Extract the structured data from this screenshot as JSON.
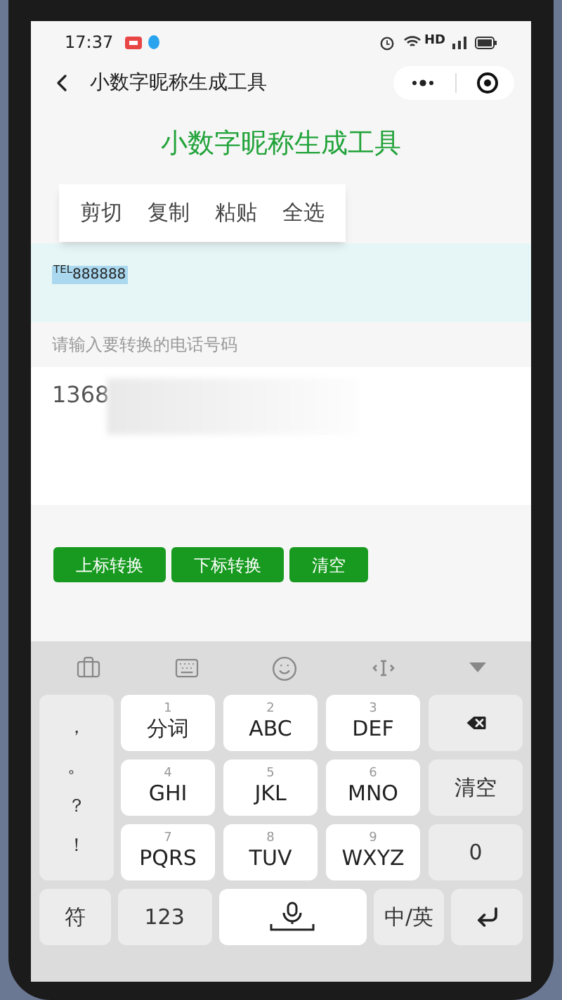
{
  "status_bar": {
    "time": "17:37",
    "network": "HD"
  },
  "nav_bar": {
    "title": "小数字昵称生成工具"
  },
  "page": {
    "heading": "小数字昵称生成工具",
    "context_menu": [
      "剪切",
      "复制",
      "粘贴",
      "全选"
    ],
    "result_text": "$^{TEL}$888888",
    "input_label": "请输入要转换的电话号码",
    "input_value": "1368",
    "buttons": [
      "上标转换",
      "下标转换",
      "清空"
    ]
  },
  "keyboard": {
    "punctuation": [
      "，",
      "。",
      "？",
      "！"
    ],
    "keys": [
      {
        "kind": "key",
        "digit": "1",
        "label": "分词"
      },
      {
        "kind": "key",
        "digit": "2",
        "label": "ABC"
      },
      {
        "kind": "key",
        "digit": "3",
        "label": "DEF"
      },
      {
        "kind": "backspace"
      },
      {
        "kind": "key",
        "digit": "4",
        "label": "GHI"
      },
      {
        "kind": "key",
        "digit": "5",
        "label": "JKL"
      },
      {
        "kind": "key",
        "digit": "6",
        "label": "MNO"
      },
      {
        "kind": "func",
        "label": "清空"
      },
      {
        "kind": "key",
        "digit": "7",
        "label": "PQRS"
      },
      {
        "kind": "key",
        "digit": "8",
        "label": "TUV"
      },
      {
        "kind": "key",
        "digit": "9",
        "label": "WXYZ"
      },
      {
        "kind": "func",
        "label": "0"
      }
    ],
    "bottom_row": [
      {
        "kind": "func",
        "label": "符"
      },
      {
        "kind": "func",
        "label": "123"
      },
      {
        "kind": "space"
      },
      {
        "kind": "func",
        "label": "中/英"
      },
      {
        "kind": "enter"
      }
    ]
  }
}
